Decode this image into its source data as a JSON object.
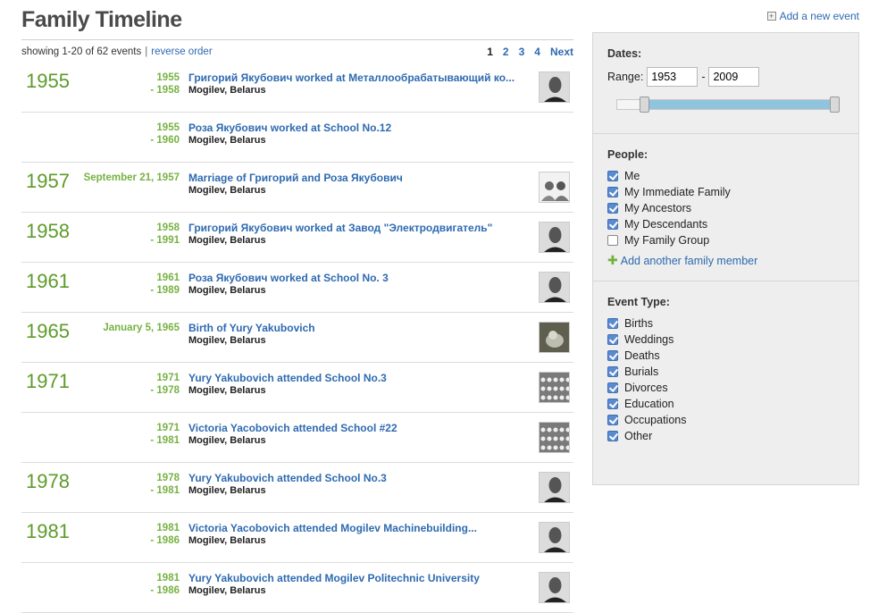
{
  "header": {
    "title": "Family Timeline",
    "add_event_label": "Add a new event",
    "add_event_icon": "plus-box-icon"
  },
  "summary": {
    "showing": "showing 1-20 of 62 events",
    "separator": "|",
    "reverse_label": "reverse order"
  },
  "pagination": {
    "pages": [
      "1",
      "2",
      "3",
      "4"
    ],
    "current": "1",
    "next_label": "Next"
  },
  "events": [
    {
      "year": "1955",
      "start": "1955",
      "end": "- 1958",
      "title": "Григорий Якубович worked at Металлообрабатывающий ко...",
      "place": "Mogilev, Belarus",
      "photo": "portrait"
    },
    {
      "year": "",
      "start": "1955",
      "end": "- 1960",
      "title": "Роза Якубович worked at School No.12",
      "place": "Mogilev, Belarus",
      "photo": ""
    },
    {
      "year": "1957",
      "start": "September 21, 1957",
      "end": "",
      "title": "Marriage of Григорий and Роза Якубович",
      "place": "Mogilev, Belarus",
      "photo": "couple"
    },
    {
      "year": "1958",
      "start": "1958",
      "end": "- 1991",
      "title": "Григорий Якубович worked at Завод \"Электродвигатель\"",
      "place": "Mogilev, Belarus",
      "photo": "portrait"
    },
    {
      "year": "1961",
      "start": "1961",
      "end": "- 1989",
      "title": "Роза Якубович worked at School No. 3",
      "place": "Mogilev, Belarus",
      "photo": "portrait"
    },
    {
      "year": "1965",
      "start": "January 5, 1965",
      "end": "",
      "title": "Birth of Yury Yakubovich",
      "place": "Mogilev, Belarus",
      "photo": "baby"
    },
    {
      "year": "1971",
      "start": "1971",
      "end": "- 1978",
      "title": "Yury Yakubovich attended School No.3",
      "place": "Mogilev, Belarus",
      "photo": "group"
    },
    {
      "year": "",
      "start": "1971",
      "end": "- 1981",
      "title": "Victoria Yacobovich attended School #22",
      "place": "Mogilev, Belarus",
      "photo": "group"
    },
    {
      "year": "1978",
      "start": "1978",
      "end": "- 1981",
      "title": "Yury Yakubovich attended School No.3",
      "place": "Mogilev, Belarus",
      "photo": "portrait"
    },
    {
      "year": "1981",
      "start": "1981",
      "end": "- 1986",
      "title": "Victoria Yacobovich attended Mogilev Machinebuilding...",
      "place": "Mogilev, Belarus",
      "photo": "portrait"
    },
    {
      "year": "",
      "start": "1981",
      "end": "- 1986",
      "title": "Yury Yakubovich attended Mogilev Politechnic University",
      "place": "Mogilev, Belarus",
      "photo": "portrait"
    }
  ],
  "filters": {
    "dates": {
      "title": "Dates:",
      "range_label": "Range:",
      "from": "1953",
      "dash": "-",
      "to": "2009",
      "slider_min_year": 1945,
      "slider_max_year": 2009
    },
    "people": {
      "title": "People:",
      "items": [
        {
          "label": "Me",
          "checked": true
        },
        {
          "label": "My Immediate Family",
          "checked": true
        },
        {
          "label": "My Ancestors",
          "checked": true
        },
        {
          "label": "My Descendants",
          "checked": true
        },
        {
          "label": "My Family Group",
          "checked": false
        }
      ],
      "add_label": "Add another family member"
    },
    "event_type": {
      "title": "Event Type:",
      "items": [
        {
          "label": "Births",
          "checked": true
        },
        {
          "label": "Weddings",
          "checked": true
        },
        {
          "label": "Deaths",
          "checked": true
        },
        {
          "label": "Burials",
          "checked": true
        },
        {
          "label": "Divorces",
          "checked": true
        },
        {
          "label": "Education",
          "checked": true
        },
        {
          "label": "Occupations",
          "checked": true
        },
        {
          "label": "Other",
          "checked": true
        }
      ]
    }
  },
  "colors": {
    "year_green": "#5d9b2a",
    "date_green": "#77b242",
    "link_blue": "#2e6ab1",
    "slider_fill": "#8fc3de"
  }
}
